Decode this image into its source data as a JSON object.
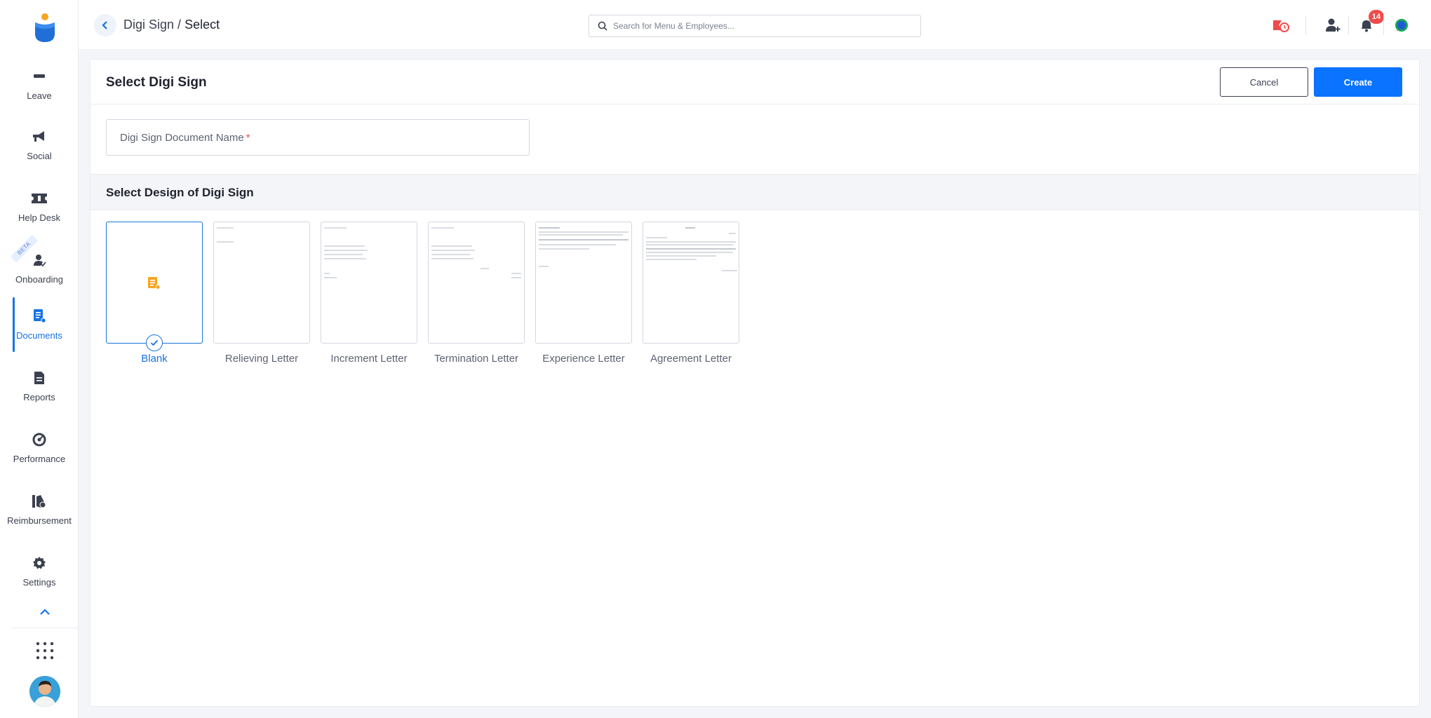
{
  "sidebar": {
    "items": [
      {
        "label": "Leave",
        "icon": "leave-icon"
      },
      {
        "label": "Social",
        "icon": "megaphone-icon"
      },
      {
        "label": "Help Desk",
        "icon": "ticket-icon"
      },
      {
        "label": "Onboarding",
        "icon": "user-check-icon",
        "tag": "BETA"
      },
      {
        "label": "Documents",
        "icon": "document-icon",
        "active": true
      },
      {
        "label": "Reports",
        "icon": "report-icon"
      },
      {
        "label": "Performance",
        "icon": "performance-icon"
      },
      {
        "label": "Reimbursement",
        "icon": "reimbursement-icon"
      },
      {
        "label": "Settings",
        "icon": "gear-icon"
      }
    ]
  },
  "header": {
    "breadcrumb_parent": "Digi Sign",
    "breadcrumb_separator": " / ",
    "breadcrumb_current": "Select",
    "search_placeholder": "Search for Menu & Employees...",
    "notification_count": "14"
  },
  "page": {
    "title": "Select Digi Sign",
    "cancel_label": "Cancel",
    "create_label": "Create",
    "name_placeholder": "Digi Sign Document Name",
    "required_mark": "*",
    "section_title": "Select Design of Digi Sign",
    "designs": [
      {
        "label": "Blank",
        "selected": true
      },
      {
        "label": "Relieving Letter",
        "selected": false
      },
      {
        "label": "Increment Letter",
        "selected": false
      },
      {
        "label": "Termination Letter",
        "selected": false
      },
      {
        "label": "Experience Letter",
        "selected": false
      },
      {
        "label": "Agreement Letter",
        "selected": false
      }
    ]
  },
  "colors": {
    "accent": "#1673e6",
    "primary_button": "#0a73ff",
    "badge": "#ef4b4b",
    "blank_icon": "#f5a623"
  }
}
